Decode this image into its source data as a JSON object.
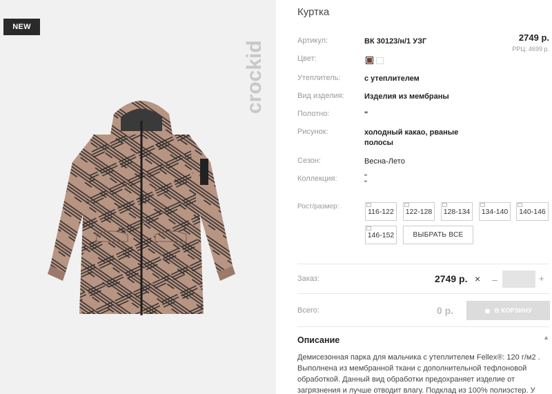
{
  "badge": "NEW",
  "brand": "crockid",
  "product": {
    "title": "Куртка",
    "price": "2749 р.",
    "rrp": "РРЦ: 4699 р."
  },
  "props": {
    "article_label": "Артикул:",
    "article_value": "ВК 30123/н/1 УЗГ",
    "color_label": "Цвет:",
    "color_swatch": "#7a3e2e",
    "insulation_label": "Утеплитель:",
    "insulation_value": "с утеплителем",
    "type_label": "Вид изделия:",
    "type_value": "Изделия из мембраны",
    "fabric_label": "Полотно:",
    "fabric_value": "\"",
    "pattern_label": "Рисунок:",
    "pattern_value_1": "холодный какао, рваные",
    "pattern_value_2": "полосы",
    "season_label": "Сезон:",
    "season_value": "Весна-Лето",
    "collection_label": "Коллекция:",
    "collection_value_1": "\"",
    "collection_value_2": "\""
  },
  "sizes": {
    "label": "Рост/размер:",
    "items": [
      "116-122",
      "122-128",
      "128-134",
      "134-140",
      "140-146",
      "146-152"
    ],
    "select_all": "ВЫБРАТЬ ВСЕ"
  },
  "order": {
    "label": "Заказ:",
    "price": "2749 р.",
    "times": "×",
    "minus": "–",
    "qty": "",
    "plus": "+"
  },
  "total": {
    "label": "Всего:",
    "value": "0 р.",
    "cart_button": "В КОРЗИНУ"
  },
  "description": {
    "title": "Описание",
    "caret": "▲",
    "text": "Демисезонная парка для мальчика с утеплителем Fellex®: 120 г/м2 . Выполнена из мембранной ткани с дополнительной тефлоновой обработкой. Данный вид обработки предохраняет изделие от загрязнения и лучше отводит влагу. Подклад из 100% полиэстер. У"
  },
  "colors": {
    "accent_dark": "#2a2a2a",
    "jacket": "#b89483",
    "stripe": "#2b2a2a"
  }
}
